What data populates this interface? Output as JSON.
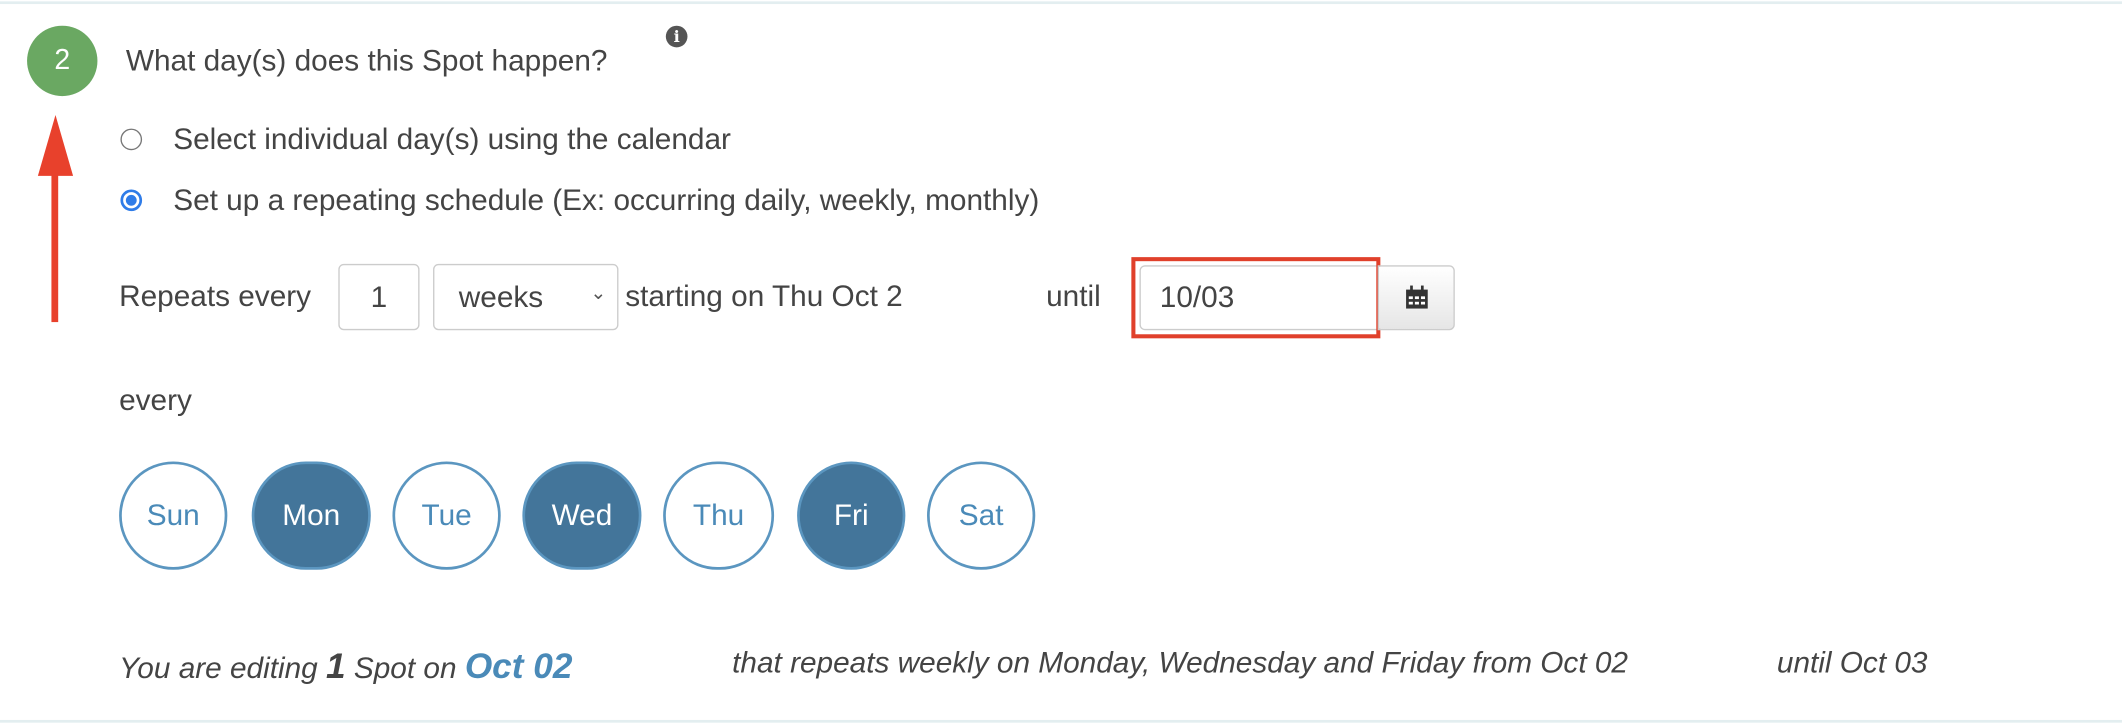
{
  "step": {
    "number": "2",
    "title": "What day(s) does this Spot happen?",
    "info_icon": "info-circle-icon"
  },
  "options": [
    {
      "label": "Select individual day(s) using the calendar",
      "checked": false
    },
    {
      "label": "Set up a repeating schedule (Ex: occurring daily, weekly, monthly)",
      "checked": true
    }
  ],
  "repeat": {
    "prefix": "Repeats every",
    "interval": "1",
    "unit": "weeks",
    "starting": "starting on Thu Oct 2",
    "until_label": "until",
    "until_value": "10/03",
    "calendar_icon": "calendar-icon"
  },
  "every_label": "every",
  "days": [
    {
      "label": "Sun",
      "selected": false
    },
    {
      "label": "Mon",
      "selected": true
    },
    {
      "label": "Tue",
      "selected": false
    },
    {
      "label": "Wed",
      "selected": true
    },
    {
      "label": "Thu",
      "selected": false
    },
    {
      "label": "Fri",
      "selected": true
    },
    {
      "label": "Sat",
      "selected": false
    }
  ],
  "summary": {
    "part1": "You are editing",
    "count": "1",
    "part2": "Spot on",
    "date": "Oct 02",
    "part3": "that repeats weekly on Monday, Wednesday and Friday from Oct 02",
    "part4": "until Oct 03"
  },
  "colors": {
    "step_green": "#6aa862",
    "day_selected": "#43759a",
    "accent_blue": "#4a8ab8",
    "annotation_red": "#e0402b",
    "radio_blue": "#2f7ce8"
  }
}
